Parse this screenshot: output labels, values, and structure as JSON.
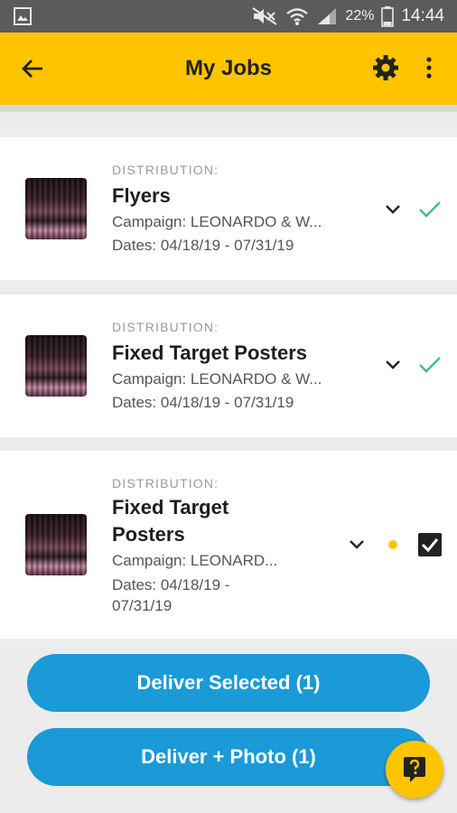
{
  "status_bar": {
    "battery": "22%",
    "time": "14:44"
  },
  "app_bar": {
    "title": "My Jobs"
  },
  "jobs": [
    {
      "category": "DISTRIBUTION:",
      "title": "Flyers",
      "campaign": "Campaign: LEONARDO & W...",
      "dates": "Dates: 04/18/19 - 07/31/19",
      "status": "delivered"
    },
    {
      "category": "DISTRIBUTION:",
      "title": "Fixed Target Posters",
      "campaign": "Campaign: LEONARDO & W...",
      "dates": "Dates: 04/18/19 - 07/31/19",
      "status": "delivered"
    },
    {
      "category": "DISTRIBUTION:",
      "title_line1": "Fixed Target",
      "title_line2": "Posters",
      "campaign": "Campaign: LEONARD...",
      "dates_line1": "Dates: 04/18/19 -",
      "dates_line2": "07/31/19",
      "status": "pending",
      "selected": true
    }
  ],
  "actions": {
    "deliver_selected": "Deliver Selected (1)",
    "deliver_photo": "Deliver + Photo (1)"
  },
  "colors": {
    "accent": "#ffc400",
    "button": "#1a9ad6",
    "check": "#3cbf8c"
  }
}
